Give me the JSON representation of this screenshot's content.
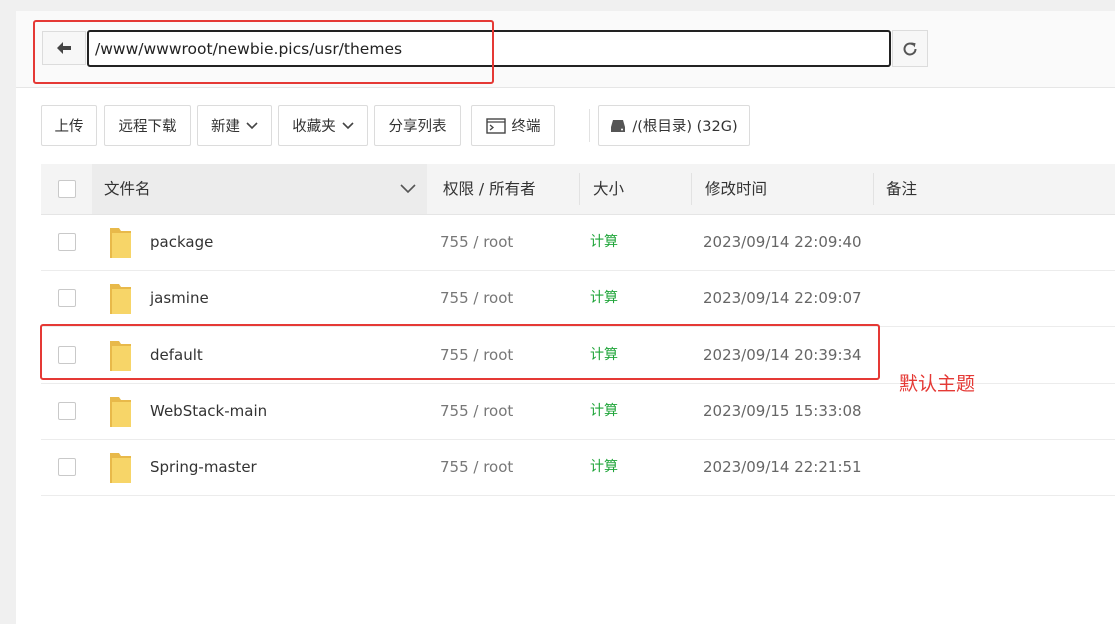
{
  "path": {
    "value": "/www/wwwroot/newbie.pics/usr/themes"
  },
  "toolbar": {
    "upload": "上传",
    "remote_download": "远程下载",
    "new": "新建",
    "favorites": "收藏夹",
    "share_list": "分享列表",
    "terminal": "终端",
    "disk": "/(根目录) (32G)"
  },
  "table": {
    "headers": {
      "name": "文件名",
      "perm_owner": "权限 / 所有者",
      "size": "大小",
      "modified": "修改时间",
      "note": "备注"
    },
    "rows": [
      {
        "name": "package",
        "perm": "755 / root",
        "size": "计算",
        "modified": "2023/09/14 22:09:40",
        "note": ""
      },
      {
        "name": "jasmine",
        "perm": "755 / root",
        "size": "计算",
        "modified": "2023/09/14 22:09:07",
        "note": ""
      },
      {
        "name": "default",
        "perm": "755 / root",
        "size": "计算",
        "modified": "2023/09/14 20:39:34",
        "note": ""
      },
      {
        "name": "WebStack-main",
        "perm": "755 / root",
        "size": "计算",
        "modified": "2023/09/15 15:33:08",
        "note": ""
      },
      {
        "name": "Spring-master",
        "perm": "755 / root",
        "size": "计算",
        "modified": "2023/09/14 22:21:51",
        "note": ""
      }
    ]
  },
  "annotation": {
    "text": "默认主题"
  },
  "colors": {
    "accent_red": "#e53935",
    "size_green": "#20a53a",
    "folder_yellow": "#f7d568"
  }
}
